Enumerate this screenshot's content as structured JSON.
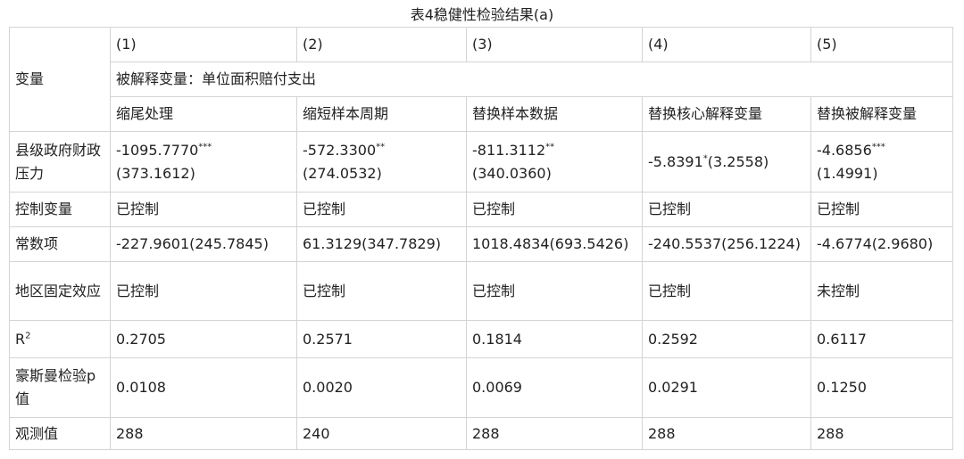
{
  "title": "表4稳健性检验结果(a)",
  "header": {
    "variable_label": "变量",
    "column_numbers": [
      "(1)",
      "(2)",
      "(3)",
      "(4)",
      "(5)"
    ],
    "dependent_variable": "被解释变量：单位面积赔付支出",
    "methods": [
      "缩尾处理",
      "缩短样本周期",
      "替换样本数据",
      "替换核心解释变量",
      "替换被解释变量"
    ]
  },
  "rows": {
    "pressure": {
      "label": "县级政府财政压力",
      "cells": [
        {
          "coef": "-1095.7770",
          "stars": "***",
          "se": "(373.1612)"
        },
        {
          "coef": "-572.3300",
          "stars": "**",
          "se": "(274.0532)"
        },
        {
          "coef": "-811.3112",
          "stars": "**",
          "se": "(340.0360)"
        },
        {
          "coef": "-5.8391",
          "stars": "*",
          "se": "(3.2558)"
        },
        {
          "coef": "-4.6856",
          "stars": "***",
          "se": "(1.4991)"
        }
      ]
    },
    "controls": {
      "label": "控制变量",
      "values": [
        "已控制",
        "已控制",
        "已控制",
        "已控制",
        "已控制"
      ]
    },
    "constant": {
      "label": "常数项",
      "values": [
        "-227.9601(245.7845)",
        "61.3129(347.7829)",
        "1018.4834(693.5426)",
        "-240.5537(256.1224)",
        "-4.6774(2.9680)"
      ]
    },
    "fixed_effects": {
      "label": "地区固定效应",
      "values": [
        "已控制",
        "已控制",
        "已控制",
        "已控制",
        "未控制"
      ]
    },
    "r2": {
      "label_base": "R",
      "label_sup": "2",
      "values": [
        "0.2705",
        "0.2571",
        "0.1814",
        "0.2592",
        "0.6117"
      ]
    },
    "hausman": {
      "label": "豪斯曼检验p值",
      "values": [
        "0.0108",
        "0.0020",
        "0.0069",
        "0.0291",
        "0.1250"
      ]
    },
    "observations": {
      "label": "观测值",
      "values": [
        "288",
        "240",
        "288",
        "288",
        "288"
      ]
    }
  }
}
